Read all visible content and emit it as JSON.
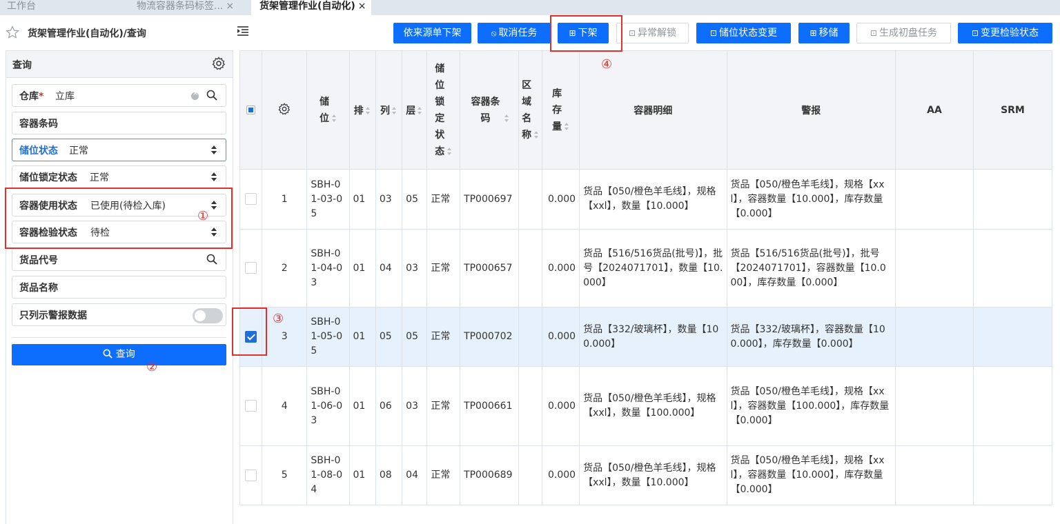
{
  "tabs": [
    {
      "label": "工作台"
    },
    {
      "label": "物流容器条码标签...",
      "close": "×"
    },
    {
      "label": "货架管理作业(自动化)",
      "close": "×"
    }
  ],
  "page_title": "货架管理作业(自动化)/查询",
  "toolbar": {
    "buttons": [
      {
        "label": "依来源单下架",
        "icon": ""
      },
      {
        "label": "取消任务",
        "icon": "⦸"
      },
      {
        "label": "下架",
        "icon": "⊞"
      },
      {
        "label": "异常解锁",
        "icon": "⊡"
      },
      {
        "label": "储位状态变更",
        "icon": "⊡"
      },
      {
        "label": "移储",
        "icon": "⊞"
      },
      {
        "label": "生成初盘任务",
        "icon": "⊡"
      },
      {
        "label": "变更检验状态",
        "icon": "⊡"
      }
    ]
  },
  "annotations": [
    "①",
    "②",
    "③",
    "④"
  ],
  "query_panel": {
    "title": "查询",
    "fields": {
      "warehouse": {
        "label": "仓库",
        "required": "*",
        "value": "立库"
      },
      "container_code": {
        "label": "容器条码"
      },
      "location_status": {
        "label": "储位状态",
        "value": "正常"
      },
      "location_lock_status": {
        "label": "储位锁定状态",
        "value": "正常"
      },
      "container_use_status": {
        "label": "容器使用状态",
        "value": "已使用(待检入库)"
      },
      "container_inspect_status": {
        "label": "容器检验状态",
        "value": "待检"
      },
      "goods_code": {
        "label": "货品代号"
      },
      "goods_name": {
        "label": "货品名称"
      },
      "alarm_only": {
        "label": "只列示警报数据",
        "on": false
      }
    },
    "query_button": "查询"
  },
  "table": {
    "headers": {
      "location": "储位",
      "row": "排",
      "col": "列",
      "layer": "层",
      "lock_status": "储位锁定状态",
      "container_code": "容器条码",
      "area": "区域名称",
      "stock": "库存量",
      "detail": "容器明细",
      "alarm": "警报",
      "aa": "AA",
      "srm": "SRM"
    },
    "rows": [
      {
        "no": "1",
        "location": "SBH-01-03-05",
        "row": "01",
        "col": "03",
        "layer": "05",
        "lock": "正常",
        "container": "TP000697",
        "area": "",
        "stock": "0.000",
        "detail": "货品【050/橙色羊毛线】，规格【xxl】，数量【10.000】",
        "alarm": "货品【050/橙色羊毛线】，规格【xxl】，容器数量【10.000】，库存数量【0.000】",
        "checked": false
      },
      {
        "no": "2",
        "location": "SBH-01-04-03",
        "row": "01",
        "col": "04",
        "layer": "03",
        "lock": "正常",
        "container": "TP000657",
        "area": "",
        "stock": "0.000",
        "detail": "货品【516/516货品(批号)】，批号【2024071701】，数量【10.000】",
        "alarm": "货品【516/516货品(批号)】，批号【2024071701】，容器数量【10.000】，库存数量【0.000】",
        "checked": false
      },
      {
        "no": "3",
        "location": "SBH-01-05-05",
        "row": "01",
        "col": "05",
        "layer": "05",
        "lock": "正常",
        "container": "TP000702",
        "area": "",
        "stock": "0.000",
        "detail": "货品【332/玻璃杯】，数量【100.000】",
        "alarm": "货品【332/玻璃杯】，容器数量【100.000】，库存数量【0.000】",
        "checked": true
      },
      {
        "no": "4",
        "location": "SBH-01-06-03",
        "row": "01",
        "col": "06",
        "layer": "03",
        "lock": "正常",
        "container": "TP000661",
        "area": "",
        "stock": "0.000",
        "detail": "货品【050/橙色羊毛线】，规格【xxl】，数量【100.000】",
        "alarm": "货品【050/橙色羊毛线】，规格【xxl】，容器数量【100.000】，库存数量【0.000】",
        "checked": false
      },
      {
        "no": "5",
        "location": "SBH-01-08-04",
        "row": "01",
        "col": "08",
        "layer": "04",
        "lock": "正常",
        "container": "TP000689",
        "area": "",
        "stock": "0.000",
        "detail": "货品【050/橙色羊毛线】，规格【xxl】，数量【10.000】",
        "alarm": "货品【050/橙色羊毛线】，规格【xxl】，容器数量【10.000】，库存数量【0.000】",
        "checked": false
      }
    ]
  },
  "colors": {
    "primary": "#0d6efd",
    "annotation": "#e0302c",
    "selected_row": "#e6f1fb"
  }
}
